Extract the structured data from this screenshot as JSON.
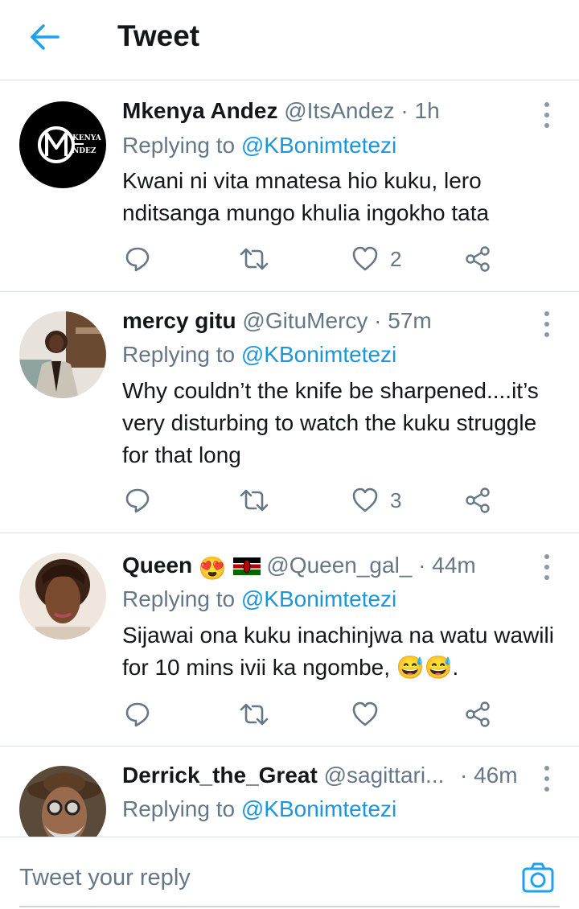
{
  "header": {
    "title": "Tweet",
    "back_icon": "arrow-left-icon",
    "accent": "#1da1f2"
  },
  "tweets": [
    {
      "name": "Mkenya Andez",
      "handle": "@ItsAndez",
      "time": "· 1h",
      "reply_label": "Replying to",
      "reply_to": "@KBonimtetezi",
      "text": "Kwani ni vita mnatesa hio kuku, lero nditsanga mungo khulia ingokho tata",
      "likes": "2",
      "avatar_logo": {
        "top": "KENYA",
        "bottom": "NDEZ"
      }
    },
    {
      "name": "mercy gitu",
      "handle": "@GituMercy",
      "time": "· 57m",
      "reply_label": "Replying to",
      "reply_to": "@KBonimtetezi",
      "text": "Why couldn’t the knife be sharpened....it’s very disturbing to watch the kuku struggle for that long",
      "likes": "3"
    },
    {
      "name": "Queen",
      "emojis": "😍",
      "flag_icon": "kenya-flag-icon",
      "handle": "@Queen_gal_",
      "time": "· 44m",
      "reply_label": "Replying to",
      "reply_to": "@KBonimtetezi",
      "text": "Sijawai ona kuku inachinjwa na watu wawili for 10 mins ivii ka ngombe, 😅😅.",
      "likes": ""
    },
    {
      "name": "Derrick_the_Great",
      "handle": "@sagittari...",
      "time": "· 46m",
      "reply_label": "Replying to",
      "reply_to": "@KBonimtetezi"
    }
  ],
  "composer": {
    "placeholder": "Tweet your reply",
    "camera_icon": "camera-icon"
  },
  "colors": {
    "blue": "#1b95e0",
    "gray": "#657786",
    "divider": "#d8dde2",
    "text": "#14171a"
  }
}
